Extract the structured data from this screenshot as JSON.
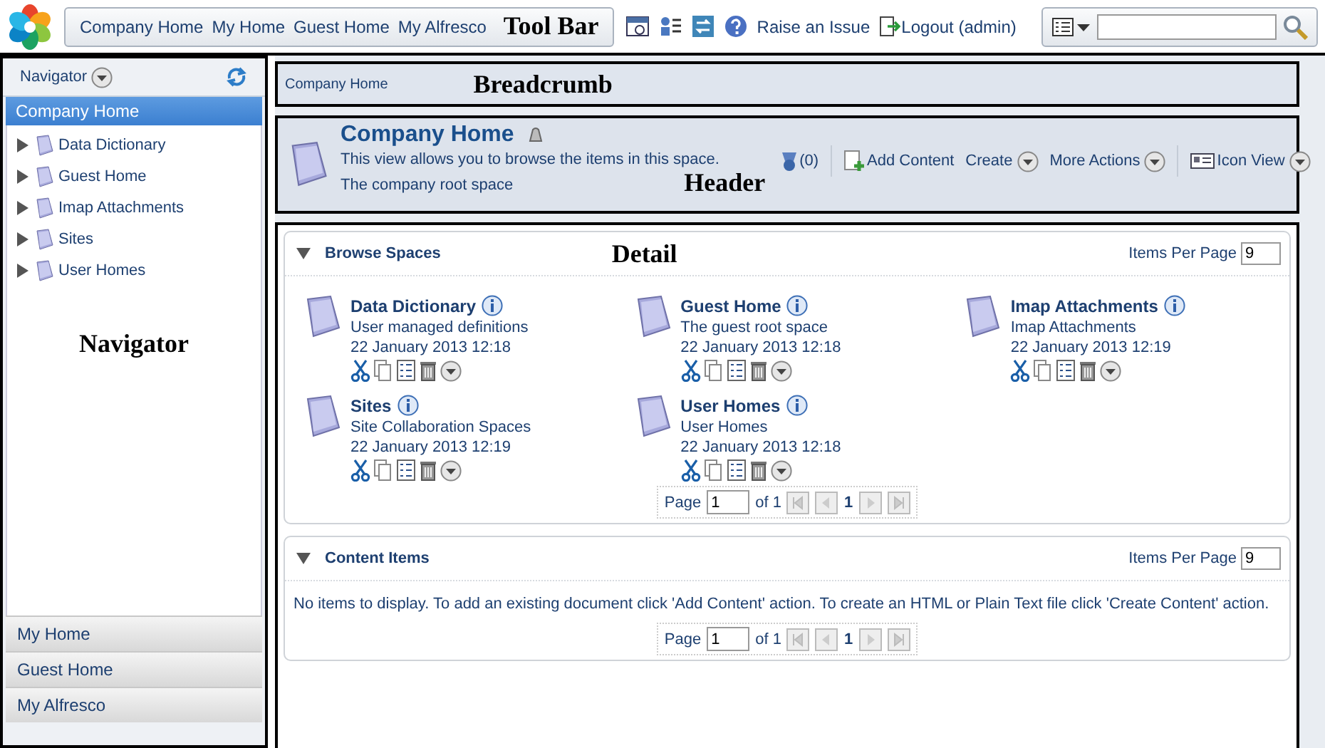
{
  "toolbar": {
    "links": [
      "Company Home",
      "My Home",
      "Guest Home",
      "My Alfresco"
    ],
    "annotation": "Tool Bar",
    "raise_issue": "Raise an Issue",
    "logout": "Logout (admin)"
  },
  "navigator": {
    "title": "Navigator",
    "root": {
      "label": "Company Home",
      "selected": true
    },
    "tree": [
      {
        "label": "Data Dictionary",
        "expanded": false
      },
      {
        "label": "Guest Home",
        "expanded": false
      },
      {
        "label": "Imap Attachments",
        "expanded": false
      },
      {
        "label": "Sites",
        "expanded": false
      },
      {
        "label": "User Homes",
        "expanded": false
      }
    ],
    "annotation": "Navigator",
    "shelf": [
      {
        "label": "My Home"
      },
      {
        "label": "Guest Home"
      },
      {
        "label": "My Alfresco"
      }
    ]
  },
  "breadcrumb": {
    "path": "Company Home",
    "annotation": "Breadcrumb"
  },
  "header": {
    "title": "Company Home",
    "description": "This view allows you to browse the items in this space.",
    "subtitle": "The company root space",
    "rules_count": "(0)",
    "annotation": "Header",
    "actions": [
      {
        "kind": "add",
        "label": "Add Content"
      },
      {
        "kind": "menu",
        "label": "Create"
      },
      {
        "kind": "menu",
        "label": "More Actions"
      },
      {
        "kind": "view",
        "label": "Icon View"
      }
    ]
  },
  "detail": {
    "annotation": "Detail",
    "browse_spaces": {
      "title": "Browse Spaces",
      "expanded": true,
      "items_per_page_label": "Items Per Page",
      "items_per_page": "9",
      "spaces": [
        {
          "name": "Data Dictionary",
          "description": "User managed definitions",
          "modified": "22 January 2013 12:18"
        },
        {
          "name": "Guest Home",
          "description": "The guest root space",
          "modified": "22 January 2013 12:18"
        },
        {
          "name": "Imap Attachments",
          "description": "Imap Attachments",
          "modified": "22 January 2013 12:19"
        },
        {
          "name": "Sites",
          "description": "Site Collaboration Spaces",
          "modified": "22 January 2013 12:19"
        },
        {
          "name": "User Homes",
          "description": "User Homes",
          "modified": "22 January 2013 12:18"
        }
      ],
      "pager": {
        "label": "Page",
        "page": "1",
        "of": "of 1",
        "current": "1"
      }
    },
    "content_items": {
      "title": "Content Items",
      "expanded": true,
      "items_per_page_label": "Items Per Page",
      "items_per_page": "9",
      "message": "No items to display. To add an existing document click 'Add Content' action. To create an HTML or Plain Text file click 'Create Content' action.",
      "pager": {
        "label": "Page",
        "page": "1",
        "of": "of 1",
        "current": "1"
      }
    }
  }
}
